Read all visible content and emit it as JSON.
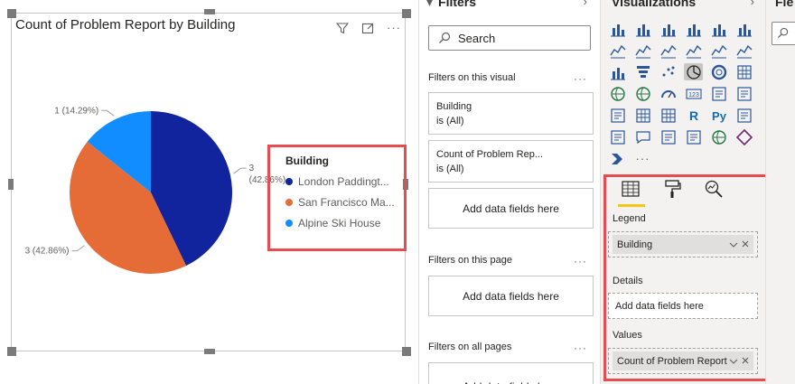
{
  "visual": {
    "title": "Count of Problem Report by Building",
    "filter_icon": "filter-icon",
    "focus_icon": "focus-mode-icon",
    "more_icon": "more-options-icon",
    "more_label": "···"
  },
  "chart_data": {
    "type": "pie",
    "title": "Count of Problem Report by Building",
    "legend_title": "Building",
    "legend_position": "right",
    "slices": [
      {
        "name": "London Paddingt...",
        "value": 3,
        "label_value": "3",
        "label_pct": "(42.86%)",
        "color": "#12239e"
      },
      {
        "name": "San Francisco Ma...",
        "value": 3,
        "label_value": "3 (42.86%)",
        "label_pct": "",
        "color": "#e66c37"
      },
      {
        "name": "Alpine Ski House",
        "value": 1,
        "label_value": "1 (14.29%)",
        "label_pct": "",
        "color": "#118dff"
      }
    ]
  },
  "filters_pane": {
    "header": "Filters",
    "collapse_icon": "chevron-right-icon",
    "search_placeholder": "Search",
    "sections": {
      "visual": {
        "label": "Filters on this visual",
        "dots": "···"
      },
      "page": {
        "label": "Filters on this page",
        "dots": "···"
      },
      "all": {
        "label": "Filters on all pages",
        "dots": "···"
      }
    },
    "cards": [
      {
        "name": "Building",
        "state": "is (All)"
      },
      {
        "name": "Count of Problem Rep...",
        "state": "is (All)"
      }
    ],
    "add_fields_label": "Add data fields here"
  },
  "viz_pane": {
    "header": "Visualizations",
    "collapse_icon": "chevron-right-icon",
    "more_label": "···",
    "wells": {
      "legend": {
        "label": "Legend",
        "field": "Building"
      },
      "details": {
        "label": "Details",
        "placeholder": "Add data fields here"
      },
      "values": {
        "label": "Values",
        "field": "Count of Problem Report"
      }
    },
    "accent": "#f2c811",
    "highlight": "#e74c50"
  },
  "fields_pane": {
    "header": "Fie"
  }
}
